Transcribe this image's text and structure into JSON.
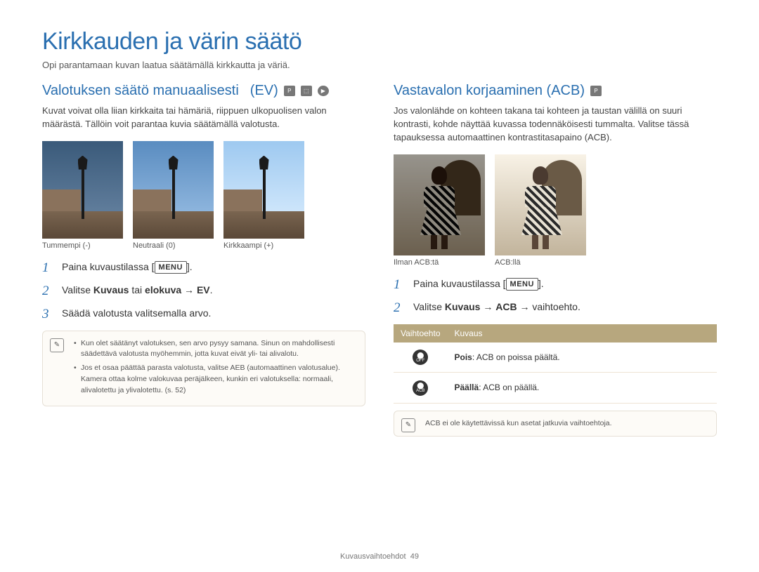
{
  "page": {
    "title": "Kirkkauden ja värin säätö",
    "intro": "Opi parantamaan kuvan laatua säätämällä kirkkautta ja väriä."
  },
  "left": {
    "heading_line1": "Valotuksen säätö manuaalisesti",
    "heading_line2": "(EV)",
    "paragraph": "Kuvat voivat olla liian kirkkaita tai hämäriä, riippuen ulkopuolisen valon määrästä. Tällöin voit parantaa kuvia säätämällä valotusta.",
    "thumbs": [
      {
        "caption": "Tummempi (-)"
      },
      {
        "caption": "Neutraali (0)"
      },
      {
        "caption": "Kirkkaampi (+)"
      }
    ],
    "steps": {
      "s1_pre": "Paina kuvaustilassa [",
      "s1_menu": "MENU",
      "s1_post": "].",
      "s2_pre": "Valitse ",
      "s2_b1": "Kuvaus",
      "s2_mid": " tai ",
      "s2_b2": "elokuva",
      "s2_arrow": " → ",
      "s2_b3": "EV",
      "s2_post": ".",
      "s3": "Säädä valotusta valitsemalla arvo."
    },
    "notes": [
      "Kun olet säätänyt valotuksen, sen arvo pysyy samana. Sinun on mahdollisesti säädettävä valotusta myöhemmin, jotta kuvat eivät yli- tai alivalotu.",
      "Jos et osaa päättää parasta valotusta, valitse AEB (automaattinen valotusalue). Kamera ottaa kolme valokuvaa peräjälkeen, kunkin eri valotuksella: normaali, alivalotettu ja ylivalotettu. (s. 52)"
    ],
    "notes_bold": "AEB"
  },
  "right": {
    "heading": "Vastavalon korjaaminen (ACB)",
    "paragraph": "Jos valonlähde on kohteen takana tai kohteen ja taustan välillä on suuri kontrasti, kohde näyttää kuvassa todennäköisesti tummalta. Valitse tässä tapauksessa automaattinen kontrastitasapaino (ACB).",
    "thumbs": [
      {
        "caption": "Ilman ACB:tä"
      },
      {
        "caption": "ACB:llä"
      }
    ],
    "steps": {
      "s1_pre": "Paina kuvaustilassa [",
      "s1_menu": "MENU",
      "s1_post": "].",
      "s2_pre": "Valitse ",
      "s2_b1": "Kuvaus",
      "s2_arrow1": " → ",
      "s2_b2": "ACB",
      "s2_arrow2": " → vaihtoehto."
    },
    "table": {
      "head_option": "Vaihtoehto",
      "head_desc": "Kuvaus",
      "rows": [
        {
          "icon_sub": "OFF",
          "bold": "Pois",
          "rest": ": ACB on poissa päältä."
        },
        {
          "icon_sub": "ACB",
          "bold": "Päällä",
          "rest": ": ACB on päällä."
        }
      ]
    },
    "note": "ACB ei ole käytettävissä kun asetat jatkuvia vaihtoehtoja."
  },
  "footer": {
    "section": "Kuvausvaihtoehdot",
    "page_num": "49"
  }
}
